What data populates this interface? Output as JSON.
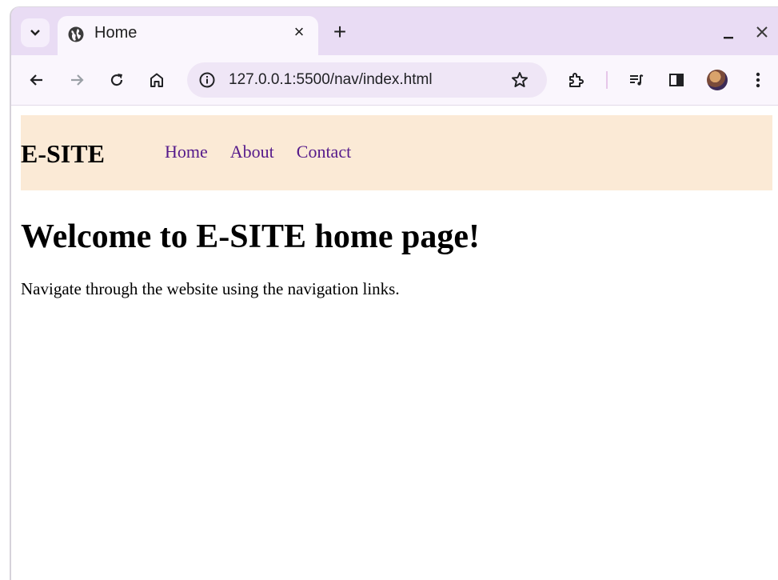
{
  "browser": {
    "tab": {
      "title": "Home"
    },
    "address_bar": {
      "url": "127.0.0.1:5500/nav/index.html"
    }
  },
  "page": {
    "brand": "E-SITE",
    "nav_links": [
      "Home",
      "About",
      "Contact"
    ],
    "heading": "Welcome to E-SITE home page!",
    "paragraph": "Navigate through the website using the navigation links."
  },
  "colors": {
    "tabstrip": "#e9dcf4",
    "toolbar": "#faf6fd",
    "navbar_bg": "#fbead6",
    "link": "#551a8b"
  },
  "icons": [
    "chevron-down-icon",
    "globe-icon",
    "close-icon",
    "plus-icon",
    "minimize-icon",
    "window-close-icon",
    "back-arrow-icon",
    "forward-arrow-icon",
    "reload-icon",
    "home-icon",
    "site-info-icon",
    "star-icon",
    "extensions-icon",
    "reading-list-icon",
    "side-panel-icon",
    "profile-avatar",
    "more-menu-icon"
  ]
}
